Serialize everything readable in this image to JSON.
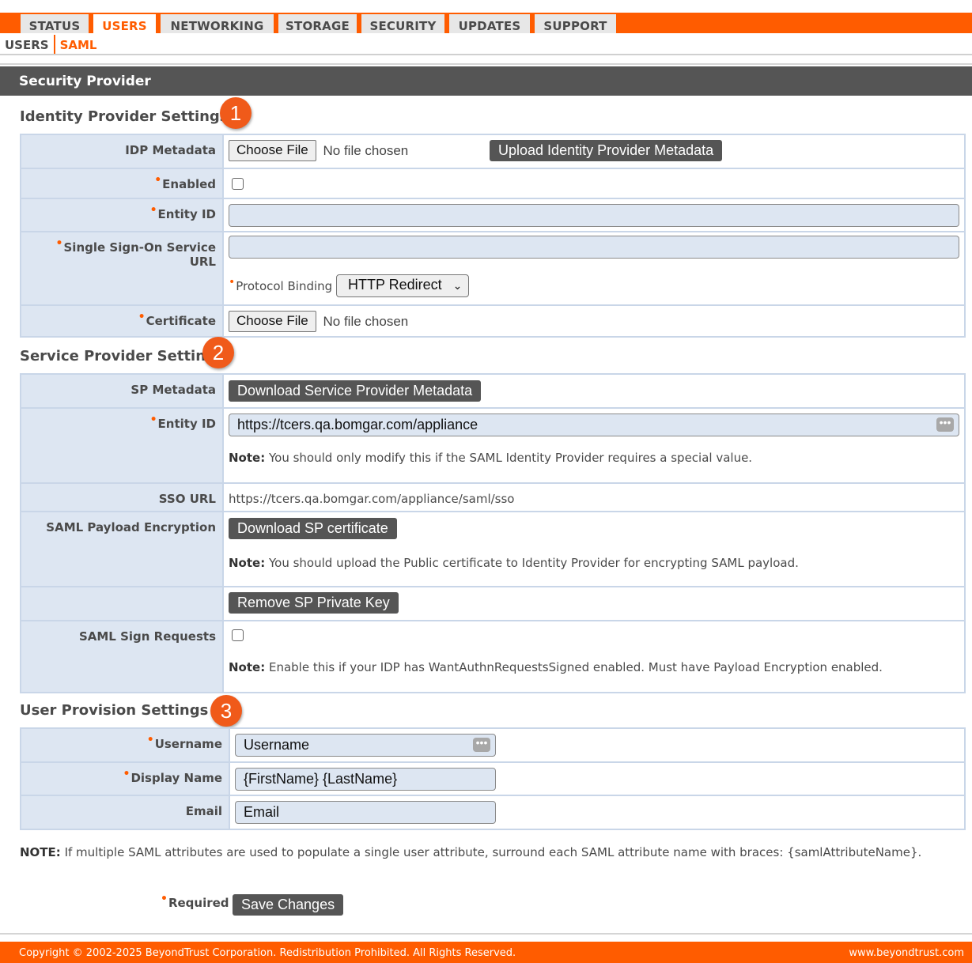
{
  "tabs": [
    "STATUS",
    "USERS",
    "NETWORKING",
    "STORAGE",
    "SECURITY",
    "UPDATES",
    "SUPPORT"
  ],
  "active_tab": "USERS",
  "subnav": [
    "USERS",
    "SAML"
  ],
  "active_subnav": "SAML",
  "section_title": "Security Provider",
  "idp": {
    "heading": "Identity Provider Settings",
    "badge": "1",
    "metadata_label": "IDP Metadata",
    "choose_file": "Choose File",
    "no_file": "No file chosen",
    "upload_button": "Upload Identity Provider Metadata",
    "enabled_label": "Enabled",
    "entity_id_label": "Entity ID",
    "entity_id_value": "",
    "sso_url_label": "Single Sign-On Service URL",
    "sso_url_value": "",
    "protocol_binding_label": "Protocol Binding",
    "protocol_binding_value": "HTTP Redirect",
    "certificate_label": "Certificate"
  },
  "sp": {
    "heading": "Service Provider Settings",
    "badge": "2",
    "metadata_label": "SP Metadata",
    "download_metadata_button": "Download Service Provider Metadata",
    "entity_id_label": "Entity ID",
    "entity_id_value": "https://tcers.qa.bomgar.com/appliance",
    "entity_note_prefix": "Note:",
    "entity_note": "You should only modify this if the SAML Identity Provider requires a special value.",
    "sso_url_label": "SSO URL",
    "sso_url_value": "https://tcers.qa.bomgar.com/appliance/saml/sso",
    "encryption_label": "SAML Payload Encryption",
    "download_cert_button": "Download SP certificate",
    "encryption_note_prefix": "Note:",
    "encryption_note": "You should upload the Public certificate to Identity Provider for encrypting SAML payload.",
    "remove_key_button": "Remove SP Private Key",
    "sign_label": "SAML Sign Requests",
    "sign_note_prefix": "Note:",
    "sign_note": "Enable this if your IDP has WantAuthnRequestsSigned enabled. Must have Payload Encryption enabled."
  },
  "provision": {
    "heading": "User Provision Settings",
    "badge": "3",
    "username_label": "Username",
    "username_value": "Username",
    "display_name_label": "Display Name",
    "display_name_value": "{FirstName} {LastName}",
    "email_label": "Email",
    "email_value": "Email"
  },
  "footnote_prefix": "NOTE:",
  "footnote": "If multiple SAML attributes are used to populate a single user attribute, surround each SAML attribute name with braces: {samlAttributeName}.",
  "required_label": "Required",
  "save_button": "Save Changes",
  "copyright": "Copyright © 2002-2025 BeyondTrust Corporation. Redistribution Prohibited. All Rights Reserved.",
  "site": "www.beyondtrust.com",
  "colors": {
    "accent": "#ff5c00",
    "label_bg": "#dde6f2",
    "header_bg": "#555555",
    "badge": "#f05a1a"
  }
}
